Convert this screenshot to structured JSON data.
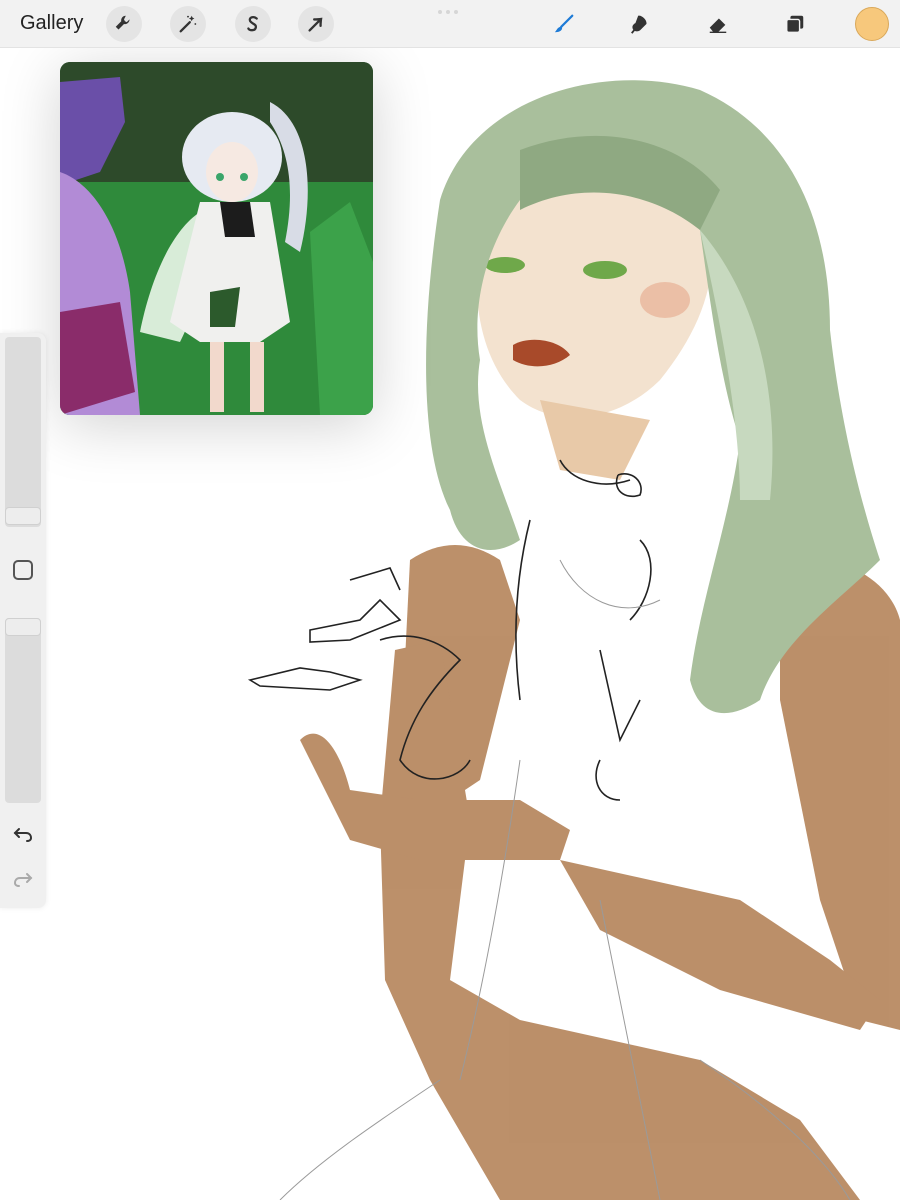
{
  "toolbar": {
    "gallery_label": "Gallery",
    "left_tools": [
      {
        "icon": "wrench-icon",
        "name": "actions"
      },
      {
        "icon": "magic-wand-icon",
        "name": "adjustments"
      },
      {
        "icon": "selection-s-icon",
        "name": "selection"
      },
      {
        "icon": "arrow-cursor-icon",
        "name": "transform"
      }
    ],
    "right_tools": [
      {
        "icon": "brush-icon",
        "name": "paint",
        "active": true
      },
      {
        "icon": "smudge-icon",
        "name": "smudge"
      },
      {
        "icon": "eraser-icon",
        "name": "eraser"
      },
      {
        "icon": "layers-icon",
        "name": "layers"
      }
    ],
    "current_color": "#f7c87c"
  },
  "sidebar": {
    "brush_size_slider": {
      "icon": "slider-icon"
    },
    "modify_button": {
      "icon": "square-icon"
    },
    "opacity_slider": {
      "icon": "slider-icon"
    },
    "undo": {
      "icon": "undo-icon"
    },
    "redo": {
      "icon": "redo-icon"
    }
  },
  "reference_window": {
    "description_icon": "reference-image-icon"
  },
  "colors": {
    "accent": "#1e7bd6",
    "hair": "#a9bf9c",
    "skin": "#b88a62"
  }
}
